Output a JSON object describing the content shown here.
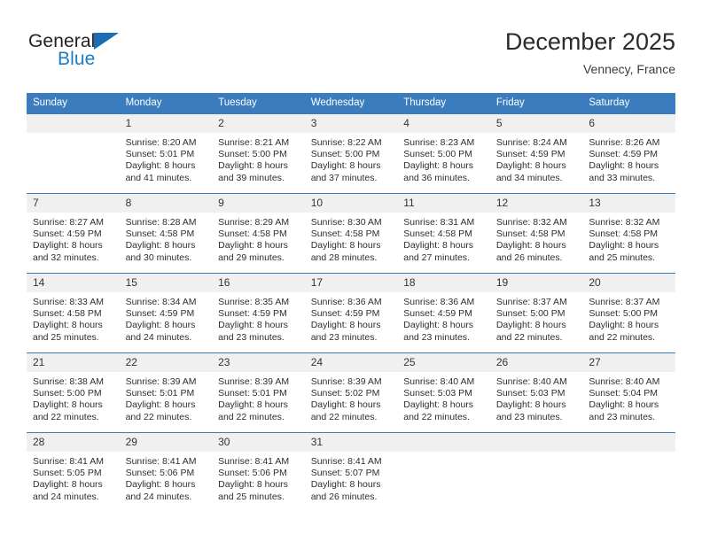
{
  "brand": {
    "name_top": "General",
    "name_bottom": "Blue",
    "accent_color": "#1a7dc4",
    "triangle_color": "#1a6fb4",
    "triangle_icon": "triangle-icon"
  },
  "header": {
    "title": "December 2025",
    "location": "Vennecy, France"
  },
  "theme": {
    "header_bg": "#3a7cbd",
    "daynum_bg": "#f0f0f0",
    "grid_line": "#3a7cbd",
    "text": "#2e2e2e"
  },
  "calendar": {
    "weekday_headers": [
      "Sunday",
      "Monday",
      "Tuesday",
      "Wednesday",
      "Thursday",
      "Friday",
      "Saturday"
    ],
    "weeks": [
      [
        {
          "day": "",
          "empty": true,
          "sunrise": "",
          "sunset": "",
          "daylight1": "",
          "daylight2": ""
        },
        {
          "day": "1",
          "empty": false,
          "sunrise": "Sunrise: 8:20 AM",
          "sunset": "Sunset: 5:01 PM",
          "daylight1": "Daylight: 8 hours",
          "daylight2": "and 41 minutes."
        },
        {
          "day": "2",
          "empty": false,
          "sunrise": "Sunrise: 8:21 AM",
          "sunset": "Sunset: 5:00 PM",
          "daylight1": "Daylight: 8 hours",
          "daylight2": "and 39 minutes."
        },
        {
          "day": "3",
          "empty": false,
          "sunrise": "Sunrise: 8:22 AM",
          "sunset": "Sunset: 5:00 PM",
          "daylight1": "Daylight: 8 hours",
          "daylight2": "and 37 minutes."
        },
        {
          "day": "4",
          "empty": false,
          "sunrise": "Sunrise: 8:23 AM",
          "sunset": "Sunset: 5:00 PM",
          "daylight1": "Daylight: 8 hours",
          "daylight2": "and 36 minutes."
        },
        {
          "day": "5",
          "empty": false,
          "sunrise": "Sunrise: 8:24 AM",
          "sunset": "Sunset: 4:59 PM",
          "daylight1": "Daylight: 8 hours",
          "daylight2": "and 34 minutes."
        },
        {
          "day": "6",
          "empty": false,
          "sunrise": "Sunrise: 8:26 AM",
          "sunset": "Sunset: 4:59 PM",
          "daylight1": "Daylight: 8 hours",
          "daylight2": "and 33 minutes."
        }
      ],
      [
        {
          "day": "7",
          "empty": false,
          "sunrise": "Sunrise: 8:27 AM",
          "sunset": "Sunset: 4:59 PM",
          "daylight1": "Daylight: 8 hours",
          "daylight2": "and 32 minutes."
        },
        {
          "day": "8",
          "empty": false,
          "sunrise": "Sunrise: 8:28 AM",
          "sunset": "Sunset: 4:58 PM",
          "daylight1": "Daylight: 8 hours",
          "daylight2": "and 30 minutes."
        },
        {
          "day": "9",
          "empty": false,
          "sunrise": "Sunrise: 8:29 AM",
          "sunset": "Sunset: 4:58 PM",
          "daylight1": "Daylight: 8 hours",
          "daylight2": "and 29 minutes."
        },
        {
          "day": "10",
          "empty": false,
          "sunrise": "Sunrise: 8:30 AM",
          "sunset": "Sunset: 4:58 PM",
          "daylight1": "Daylight: 8 hours",
          "daylight2": "and 28 minutes."
        },
        {
          "day": "11",
          "empty": false,
          "sunrise": "Sunrise: 8:31 AM",
          "sunset": "Sunset: 4:58 PM",
          "daylight1": "Daylight: 8 hours",
          "daylight2": "and 27 minutes."
        },
        {
          "day": "12",
          "empty": false,
          "sunrise": "Sunrise: 8:32 AM",
          "sunset": "Sunset: 4:58 PM",
          "daylight1": "Daylight: 8 hours",
          "daylight2": "and 26 minutes."
        },
        {
          "day": "13",
          "empty": false,
          "sunrise": "Sunrise: 8:32 AM",
          "sunset": "Sunset: 4:58 PM",
          "daylight1": "Daylight: 8 hours",
          "daylight2": "and 25 minutes."
        }
      ],
      [
        {
          "day": "14",
          "empty": false,
          "sunrise": "Sunrise: 8:33 AM",
          "sunset": "Sunset: 4:58 PM",
          "daylight1": "Daylight: 8 hours",
          "daylight2": "and 25 minutes."
        },
        {
          "day": "15",
          "empty": false,
          "sunrise": "Sunrise: 8:34 AM",
          "sunset": "Sunset: 4:59 PM",
          "daylight1": "Daylight: 8 hours",
          "daylight2": "and 24 minutes."
        },
        {
          "day": "16",
          "empty": false,
          "sunrise": "Sunrise: 8:35 AM",
          "sunset": "Sunset: 4:59 PM",
          "daylight1": "Daylight: 8 hours",
          "daylight2": "and 23 minutes."
        },
        {
          "day": "17",
          "empty": false,
          "sunrise": "Sunrise: 8:36 AM",
          "sunset": "Sunset: 4:59 PM",
          "daylight1": "Daylight: 8 hours",
          "daylight2": "and 23 minutes."
        },
        {
          "day": "18",
          "empty": false,
          "sunrise": "Sunrise: 8:36 AM",
          "sunset": "Sunset: 4:59 PM",
          "daylight1": "Daylight: 8 hours",
          "daylight2": "and 23 minutes."
        },
        {
          "day": "19",
          "empty": false,
          "sunrise": "Sunrise: 8:37 AM",
          "sunset": "Sunset: 5:00 PM",
          "daylight1": "Daylight: 8 hours",
          "daylight2": "and 22 minutes."
        },
        {
          "day": "20",
          "empty": false,
          "sunrise": "Sunrise: 8:37 AM",
          "sunset": "Sunset: 5:00 PM",
          "daylight1": "Daylight: 8 hours",
          "daylight2": "and 22 minutes."
        }
      ],
      [
        {
          "day": "21",
          "empty": false,
          "sunrise": "Sunrise: 8:38 AM",
          "sunset": "Sunset: 5:00 PM",
          "daylight1": "Daylight: 8 hours",
          "daylight2": "and 22 minutes."
        },
        {
          "day": "22",
          "empty": false,
          "sunrise": "Sunrise: 8:39 AM",
          "sunset": "Sunset: 5:01 PM",
          "daylight1": "Daylight: 8 hours",
          "daylight2": "and 22 minutes."
        },
        {
          "day": "23",
          "empty": false,
          "sunrise": "Sunrise: 8:39 AM",
          "sunset": "Sunset: 5:01 PM",
          "daylight1": "Daylight: 8 hours",
          "daylight2": "and 22 minutes."
        },
        {
          "day": "24",
          "empty": false,
          "sunrise": "Sunrise: 8:39 AM",
          "sunset": "Sunset: 5:02 PM",
          "daylight1": "Daylight: 8 hours",
          "daylight2": "and 22 minutes."
        },
        {
          "day": "25",
          "empty": false,
          "sunrise": "Sunrise: 8:40 AM",
          "sunset": "Sunset: 5:03 PM",
          "daylight1": "Daylight: 8 hours",
          "daylight2": "and 22 minutes."
        },
        {
          "day": "26",
          "empty": false,
          "sunrise": "Sunrise: 8:40 AM",
          "sunset": "Sunset: 5:03 PM",
          "daylight1": "Daylight: 8 hours",
          "daylight2": "and 23 minutes."
        },
        {
          "day": "27",
          "empty": false,
          "sunrise": "Sunrise: 8:40 AM",
          "sunset": "Sunset: 5:04 PM",
          "daylight1": "Daylight: 8 hours",
          "daylight2": "and 23 minutes."
        }
      ],
      [
        {
          "day": "28",
          "empty": false,
          "sunrise": "Sunrise: 8:41 AM",
          "sunset": "Sunset: 5:05 PM",
          "daylight1": "Daylight: 8 hours",
          "daylight2": "and 24 minutes."
        },
        {
          "day": "29",
          "empty": false,
          "sunrise": "Sunrise: 8:41 AM",
          "sunset": "Sunset: 5:06 PM",
          "daylight1": "Daylight: 8 hours",
          "daylight2": "and 24 minutes."
        },
        {
          "day": "30",
          "empty": false,
          "sunrise": "Sunrise: 8:41 AM",
          "sunset": "Sunset: 5:06 PM",
          "daylight1": "Daylight: 8 hours",
          "daylight2": "and 25 minutes."
        },
        {
          "day": "31",
          "empty": false,
          "sunrise": "Sunrise: 8:41 AM",
          "sunset": "Sunset: 5:07 PM",
          "daylight1": "Daylight: 8 hours",
          "daylight2": "and 26 minutes."
        },
        {
          "day": "",
          "empty": true,
          "sunrise": "",
          "sunset": "",
          "daylight1": "",
          "daylight2": ""
        },
        {
          "day": "",
          "empty": true,
          "sunrise": "",
          "sunset": "",
          "daylight1": "",
          "daylight2": ""
        },
        {
          "day": "",
          "empty": true,
          "sunrise": "",
          "sunset": "",
          "daylight1": "",
          "daylight2": ""
        }
      ]
    ]
  }
}
